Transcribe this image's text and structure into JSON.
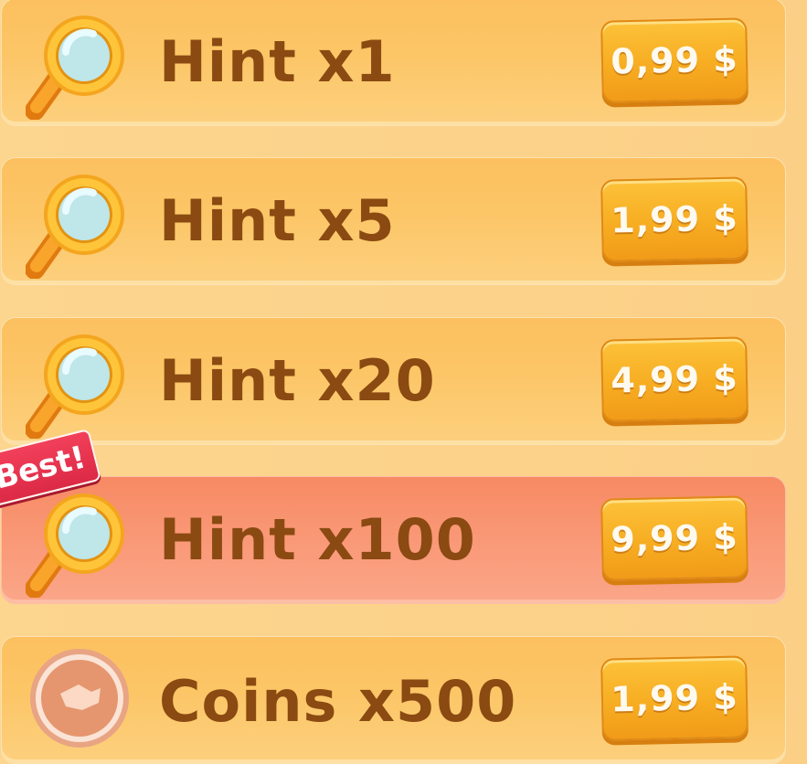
{
  "shop": {
    "items": [
      {
        "label": "Hint x1",
        "price": "0,99 $",
        "icon": "magnifier-icon"
      },
      {
        "label": "Hint x5",
        "price": "1,99 $",
        "icon": "magnifier-icon"
      },
      {
        "label": "Hint x20",
        "price": "4,99 $",
        "icon": "magnifier-icon"
      },
      {
        "label": "Hint x100",
        "price": "9,99 $",
        "icon": "magnifier-icon",
        "badge": "Best!"
      },
      {
        "label": "Coins x500",
        "price": "1,99 $",
        "icon": "coin-icon"
      }
    ]
  },
  "colors": {
    "background": "#fcd58e",
    "row": "#fcc565",
    "best_row": "#f99775",
    "price_button": "#f7ad22",
    "label_text": "#8a4a12",
    "badge": "#e3324d"
  }
}
